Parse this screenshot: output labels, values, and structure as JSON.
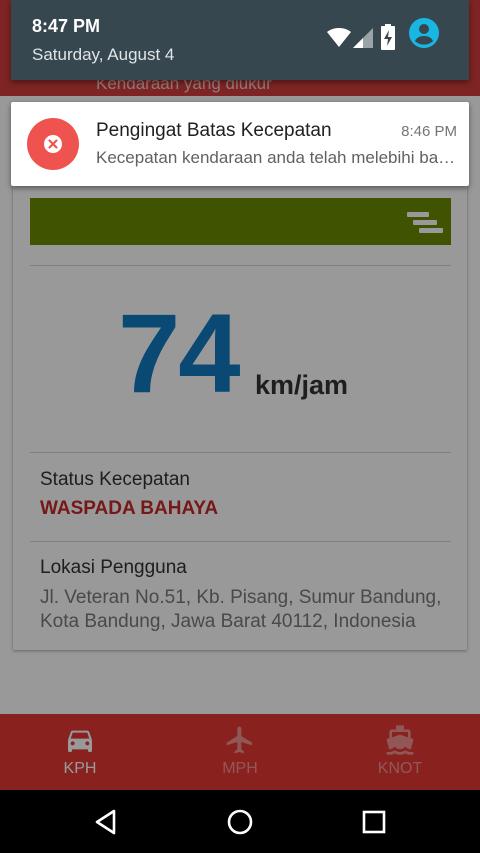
{
  "status_bar": {
    "time": "8:47 PM",
    "date": "Saturday, August 4"
  },
  "notification": {
    "title": "Pengingat Batas Kecepatan",
    "time": "8:46 PM",
    "body": "Kecepatan kendaraan anda telah melebihi batas yang ditentukan",
    "icon": "close-circle-icon",
    "icon_color": "#ef5350"
  },
  "app": {
    "topbar_text": "Kendaraan yang diukur",
    "speed_bar_color": "#6b8a00",
    "speed": "74",
    "speed_unit": "km/jam",
    "status_label": "Status Kecepatan",
    "status_value": "WASPADA BAHAYA",
    "location_label": "Lokasi Pengguna",
    "location_value": "Jl. Veteran No.51, Kb. Pisang, Sumur Bandung, Kota Bandung, Jawa Barat 40112, Indonesia",
    "accent_color": "#e53935",
    "speed_color": "#0f7ac0"
  },
  "bottom_nav": {
    "items": [
      {
        "label": "KPH",
        "icon": "car-icon",
        "active": true
      },
      {
        "label": "MPH",
        "icon": "airplane-icon",
        "active": false
      },
      {
        "label": "KNOT",
        "icon": "ship-icon",
        "active": false
      }
    ]
  }
}
